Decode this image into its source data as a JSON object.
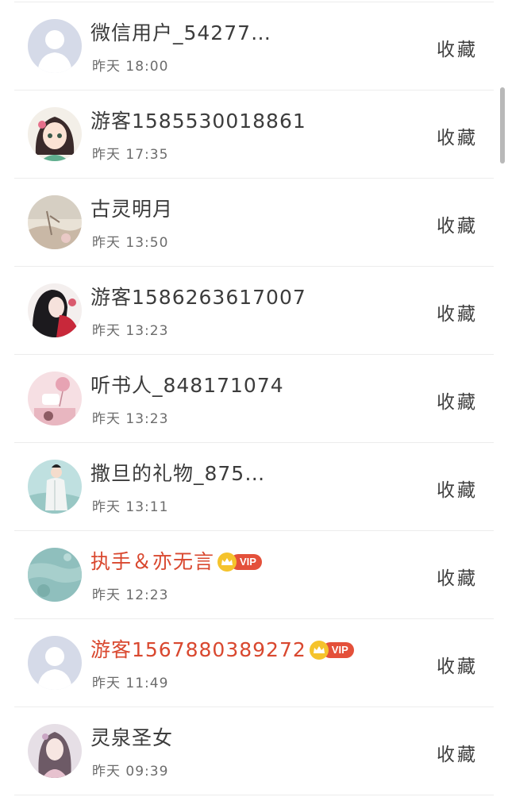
{
  "fav_label": "收藏",
  "vip_label": "VIP",
  "items": [
    {
      "name": "微信用户_54277…",
      "time": "昨天 18:00",
      "vip": false,
      "avatar": "default-avatar-icon"
    },
    {
      "name": "游客1585530018861",
      "time": "昨天 17:35",
      "vip": false,
      "avatar": "anime-girl-avatar"
    },
    {
      "name": "古灵明月",
      "time": "昨天 13:50",
      "vip": false,
      "avatar": "landscape-avatar"
    },
    {
      "name": "游客1586263617007",
      "time": "昨天 13:23",
      "vip": false,
      "avatar": "woman-portrait-avatar"
    },
    {
      "name": "听书人_848171074",
      "time": "昨天 13:23",
      "vip": false,
      "avatar": "pink-balloon-avatar"
    },
    {
      "name": "撒旦的礼物_875…",
      "time": "昨天 13:11",
      "vip": false,
      "avatar": "man-in-white-avatar"
    },
    {
      "name": "执手＆亦无言",
      "time": "昨天 12:23",
      "vip": true,
      "avatar": "teal-water-avatar"
    },
    {
      "name": "游客1567880389272",
      "time": "昨天 11:49",
      "vip": true,
      "avatar": "default-avatar-icon"
    },
    {
      "name": "灵泉圣女",
      "time": "昨天 09:39",
      "vip": false,
      "avatar": "fantasy-lady-avatar"
    }
  ],
  "colors": {
    "vip_name": "#d9482f",
    "vip_badge": "#e4503a",
    "crown": "#f5c32c",
    "divider": "#ececec"
  }
}
